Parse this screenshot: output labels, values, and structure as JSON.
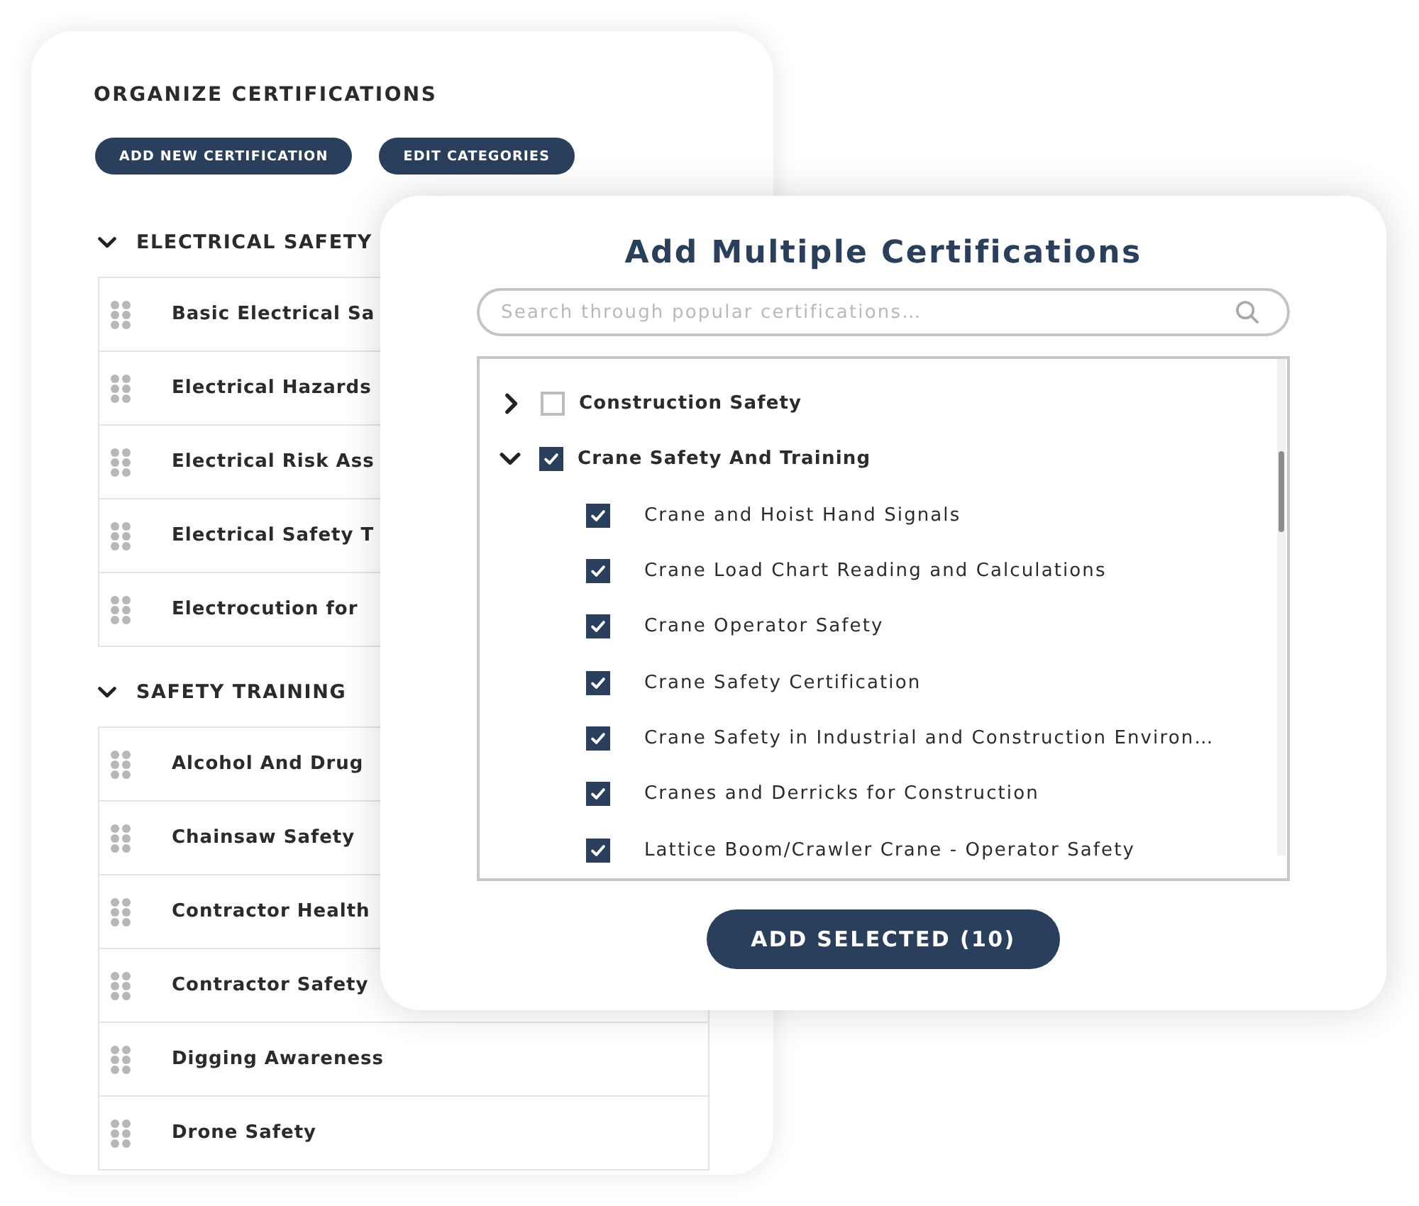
{
  "organize_panel": {
    "title": "ORGANIZE CERTIFICATIONS",
    "buttons": [
      {
        "label": "ADD NEW CERTIFICATION"
      },
      {
        "label": "EDIT CATEGORIES"
      }
    ],
    "categories": [
      {
        "name": "ELECTRICAL SAFETY",
        "expanded": true,
        "children": [
          "Basic Electrical Sa",
          "Electrical Hazards",
          "Electrical Risk Ass",
          "Electrical Safety T",
          "Electrocution for"
        ]
      },
      {
        "name": "SAFETY TRAINING",
        "expanded": true,
        "children": [
          "Alcohol And Drug",
          "Chainsaw Safety",
          "Contractor Health",
          "Contractor Safety",
          "Digging Awareness",
          "Drone Safety"
        ]
      }
    ]
  },
  "add_dialog": {
    "title": "Add Multiple Certifications",
    "search": {
      "placeholder": "Search through popular certifications…"
    },
    "tree": [
      {
        "label": "Construction Safety",
        "expanded": false,
        "checked": false
      },
      {
        "label": "Crane Safety And Training",
        "expanded": true,
        "checked": true,
        "children": [
          {
            "label": "Crane and Hoist Hand Signals",
            "checked": true
          },
          {
            "label": "Crane Load Chart Reading and Calculations",
            "checked": true
          },
          {
            "label": "Crane Operator Safety",
            "checked": true
          },
          {
            "label": "Crane Safety Certification",
            "checked": true
          },
          {
            "label": "Crane Safety in Industrial and Construction Environ…",
            "checked": true
          },
          {
            "label": "Cranes and Derricks for Construction",
            "checked": true
          },
          {
            "label": "Lattice Boom/Crawler Crane - Operator Safety",
            "checked": true
          }
        ]
      }
    ],
    "button": {
      "label": "ADD SELECTED (10)"
    }
  }
}
